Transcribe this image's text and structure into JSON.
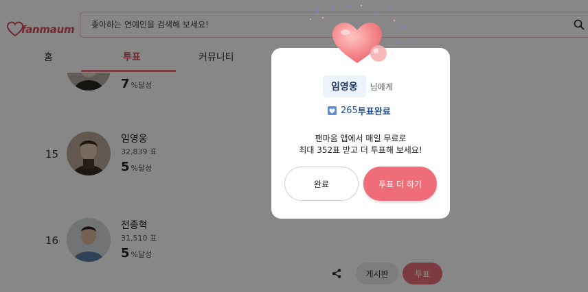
{
  "header": {
    "logo_text": "fanmaum",
    "search_placeholder": "좋아하는 연예인을 검색해 보세요!"
  },
  "tabs": [
    {
      "label": "홈"
    },
    {
      "label": "투표"
    },
    {
      "label": "커뮤니티"
    }
  ],
  "ranking": {
    "partial": {
      "percent": "7",
      "percent_suffix": "%달성"
    },
    "rows": [
      {
        "rank": "15",
        "name": "임영웅",
        "votes": "32,839 표",
        "percent": "5",
        "percent_suffix": "%달성"
      },
      {
        "rank": "16",
        "name": "전종혁",
        "votes": "31,510 표",
        "percent": "5",
        "percent_suffix": "%달성"
      }
    ]
  },
  "bottom_bar": {
    "board_label": "게시판",
    "vote_label": "투표"
  },
  "modal": {
    "recipient_name": "임영웅",
    "recipient_suffix": "님에게",
    "vote_count": "265",
    "vote_done_label": "투표완료",
    "message_line1": "팬마음 앱에서 매일 무료로",
    "message_line2": "최대 352표 받고 더 투표해 보세요!",
    "done_button": "완료",
    "more_button": "투표 더 하기"
  },
  "colors": {
    "accent": "#e8707c",
    "brand": "#d94b5e"
  }
}
